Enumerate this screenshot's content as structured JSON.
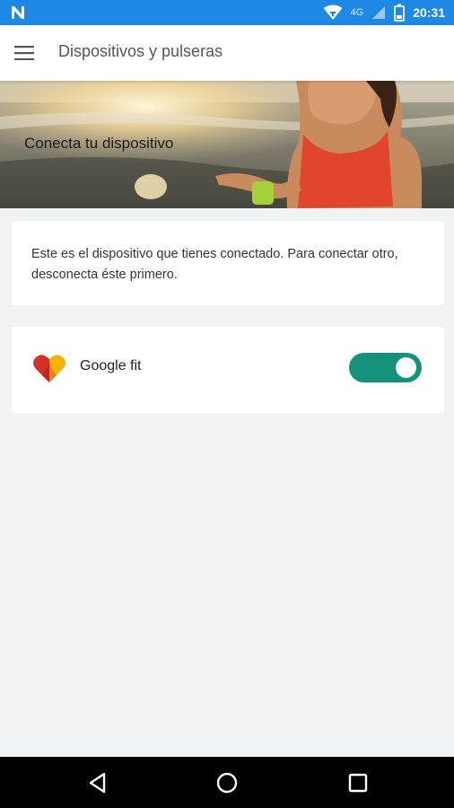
{
  "status_bar": {
    "network_type": "4G",
    "time": "20:31",
    "icons": [
      "notification-n-icon",
      "wifi-icon",
      "signal-icon",
      "battery-icon"
    ],
    "color": "#1e88e5"
  },
  "app_bar": {
    "title": "Dispositivos y pulseras",
    "menu_icon": "hamburger-menu-icon"
  },
  "hero": {
    "title": "Conecta tu dispositivo"
  },
  "info_card": {
    "text": "Este es el dispositivo que tienes conectado. Para conectar otro, desconecta éste primero."
  },
  "device": {
    "name": "Google fit",
    "icon": "google-fit-heart-icon",
    "enabled": true,
    "toggle_color": "#14917a"
  },
  "nav_bar": {
    "buttons": [
      "back-icon",
      "home-icon",
      "recents-icon"
    ]
  }
}
